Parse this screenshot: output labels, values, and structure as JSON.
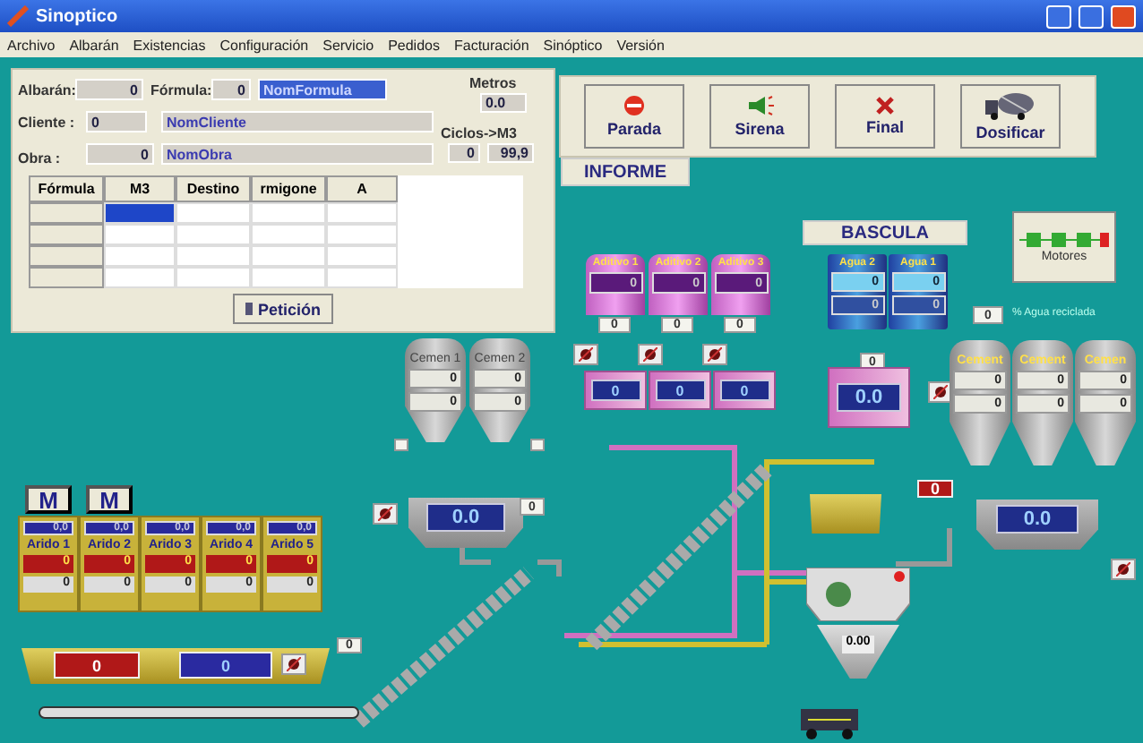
{
  "window": {
    "title": "Sinoptico"
  },
  "menu": [
    "Archivo",
    "Albarán",
    "Existencias",
    "Configuración",
    "Servicio",
    "Pedidos",
    "Facturación",
    "Sinóptico",
    "Versión"
  ],
  "form": {
    "albaran": {
      "label": "Albarán:",
      "value": "0"
    },
    "formula": {
      "label": "Fórmula:",
      "value": "0",
      "name": "NomFormula"
    },
    "cliente": {
      "label": "Cliente :",
      "value": "0",
      "name": "NomCliente"
    },
    "obra": {
      "label": "Obra :",
      "value": "0",
      "name": "NomObra"
    },
    "metros": {
      "label": "Metros",
      "value": "0.0"
    },
    "ciclos": {
      "label": "Ciclos->M3",
      "values": [
        "0",
        "99,9"
      ]
    }
  },
  "table": {
    "columns": [
      "Fórmula",
      "M3",
      "Destino",
      "rmigone",
      "A"
    ],
    "rows": [
      {
        "selected": true
      },
      {
        "selected": false
      },
      {
        "selected": false
      },
      {
        "selected": false
      }
    ]
  },
  "request_button": "Petición",
  "actions": [
    {
      "label": "Parada",
      "kind": "stop"
    },
    {
      "label": "Sirena",
      "kind": "siren"
    },
    {
      "label": "Final",
      "kind": "end"
    },
    {
      "label": "Dosificar",
      "kind": "truck"
    }
  ],
  "report_button": "INFORME",
  "scale_title": "BASCULA",
  "motors": {
    "label": "Motores"
  },
  "recycled_water": {
    "value": "0",
    "label": "% Agua reciclada"
  },
  "additives": {
    "tanks": [
      {
        "name": "Aditivo 1",
        "value": "0",
        "counter": "0"
      },
      {
        "name": "Aditivo 2",
        "value": "0",
        "counter": "0"
      },
      {
        "name": "Aditivo 3",
        "value": "0",
        "counter": "0"
      }
    ],
    "scales": [
      "0",
      "0",
      "0"
    ]
  },
  "waters": {
    "tanks": [
      {
        "name": "Agua 2",
        "value": "0",
        "value_2": "0"
      },
      {
        "name": "Agua 1",
        "value": "0",
        "value_2": "0"
      }
    ],
    "counter": "0",
    "scale": "0.0"
  },
  "cement_left": {
    "silos": [
      {
        "name": "Cemen 1",
        "value": "0",
        "value_2": "0"
      },
      {
        "name": "Cemen 2",
        "value": "0",
        "value_2": "0"
      }
    ],
    "scale": "0.0",
    "counter": "0"
  },
  "cement_right": {
    "silos": [
      {
        "name": "Cement",
        "value": "0",
        "value_2": "0"
      },
      {
        "name": "Cement",
        "value": "0",
        "value_2": "0"
      },
      {
        "name": "Cemen",
        "value": "0",
        "value_2": "0"
      }
    ],
    "scale": "0.0",
    "counter": "0"
  },
  "aggregates": {
    "modes": [
      "M",
      "M"
    ],
    "bins": [
      {
        "name": "Arido 1",
        "reading": "0,0",
        "value": "0",
        "value_2": "0"
      },
      {
        "name": "Arido 2",
        "reading": "0,0",
        "value": "0",
        "value_2": "0"
      },
      {
        "name": "Arido 3",
        "reading": "0,0",
        "value": "0",
        "value_2": "0"
      },
      {
        "name": "Arido 4",
        "reading": "0,0",
        "value": "0",
        "value_2": "0"
      },
      {
        "name": "Arido 5",
        "reading": "0,0",
        "value": "0",
        "value_2": "0"
      }
    ]
  },
  "hopper": {
    "value": "0",
    "value_2": "0",
    "counter": "0"
  },
  "mixer": {
    "output": "0.00"
  }
}
